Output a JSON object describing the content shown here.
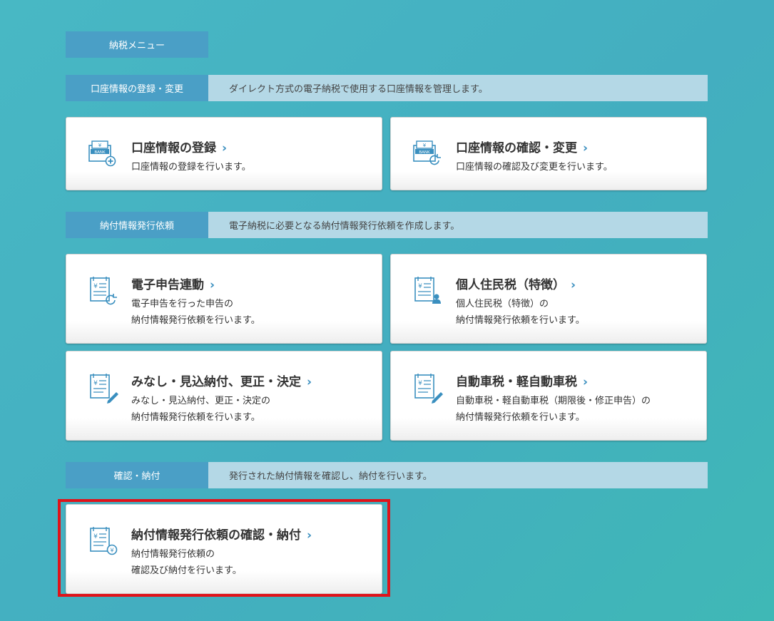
{
  "menu_tag": "納税メニュー",
  "sections": {
    "account": {
      "label": "口座情報の登録・変更",
      "desc": "ダイレクト方式の電子納税で使用する口座情報を管理します。"
    },
    "issue": {
      "label": "納付情報発行依頼",
      "desc": "電子納税に必要となる納付情報発行依頼を作成します。"
    },
    "confirm": {
      "label": "確認・納付",
      "desc": "発行された納付情報を確認し、納付を行います。"
    }
  },
  "cards": {
    "account_register": {
      "title": "口座情報の登録",
      "d1": "口座情報の登録を行います。",
      "icon": "bank-add-icon"
    },
    "account_change": {
      "title": "口座情報の確認・変更",
      "d1": "口座情報の確認及び変更を行います。",
      "icon": "bank-refresh-icon"
    },
    "e_filing": {
      "title": "電子申告連動",
      "d1": "電子申告を行った申告の",
      "d2": "納付情報発行依頼を行います。",
      "icon": "document-refresh-icon"
    },
    "resident_tax": {
      "title": "個人住民税（特徴）",
      "d1": "個人住民税（特徴）の",
      "d2": "納付情報発行依頼を行います。",
      "icon": "document-person-icon"
    },
    "deemed": {
      "title": "みなし・見込納付、更正・決定",
      "d1": "みなし・見込納付、更正・決定の",
      "d2": "納付情報発行依頼を行います。",
      "icon": "document-pen-icon"
    },
    "auto_tax": {
      "title": "自動車税・軽自動車税",
      "d1": "自動車税・軽自動車税（期限後・修正申告）の",
      "d2": "納付情報発行依頼を行います。",
      "icon": "document-pen-icon"
    },
    "confirm_pay": {
      "title": "納付情報発行依頼の確認・納付",
      "d1": "納付情報発行依頼の",
      "d2": "確認及び納付を行います。",
      "icon": "document-yen-icon"
    }
  },
  "chevron": "›",
  "colors": {
    "accent": "#4a9fc6",
    "desc_bg": "#b4d8e6",
    "highlight": "#e0131a"
  }
}
